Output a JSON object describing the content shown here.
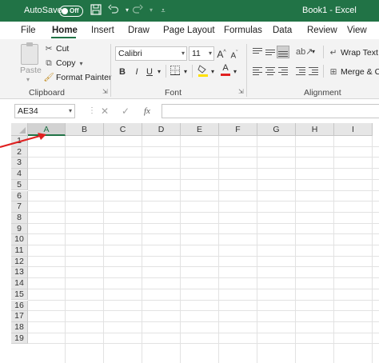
{
  "titlebar": {
    "autosave_label": "AutoSave",
    "autosave_state": "Off",
    "title": "Book1  -  Excel"
  },
  "menu": {
    "tabs": [
      "File",
      "Home",
      "Insert",
      "Draw",
      "Page Layout",
      "Formulas",
      "Data",
      "Review",
      "View"
    ],
    "active": "Home"
  },
  "ribbon": {
    "clipboard": {
      "label": "Clipboard",
      "paste": "Paste",
      "cut": "Cut",
      "copy": "Copy",
      "format_painter": "Format Painter"
    },
    "font": {
      "label": "Font",
      "font_name": "Calibri",
      "font_size": "11",
      "bold": "B",
      "italic": "I",
      "underline": "U",
      "grow": "A",
      "shrink": "A",
      "color_a": "A"
    },
    "alignment": {
      "label": "Alignment",
      "wrap_text": "Wrap Text",
      "merge": "Merge & Ce"
    }
  },
  "formula_bar": {
    "name_box": "AE34",
    "fx": "fx",
    "cancel": "✕",
    "enter": "✓",
    "value": ""
  },
  "grid": {
    "columns": [
      "A",
      "B",
      "C",
      "D",
      "E",
      "F",
      "G",
      "H",
      "I"
    ],
    "rows": [
      "1",
      "2",
      "3",
      "4",
      "5",
      "6",
      "7",
      "8",
      "9",
      "10",
      "11",
      "12",
      "13",
      "14",
      "15",
      "16",
      "17",
      "18",
      "19"
    ],
    "selected_column": "A"
  },
  "colors": {
    "accent": "#217346",
    "annotation_arrow": "#e02020",
    "font_color_bar": "#e02020",
    "fill_color_bar": "#ffe000"
  }
}
